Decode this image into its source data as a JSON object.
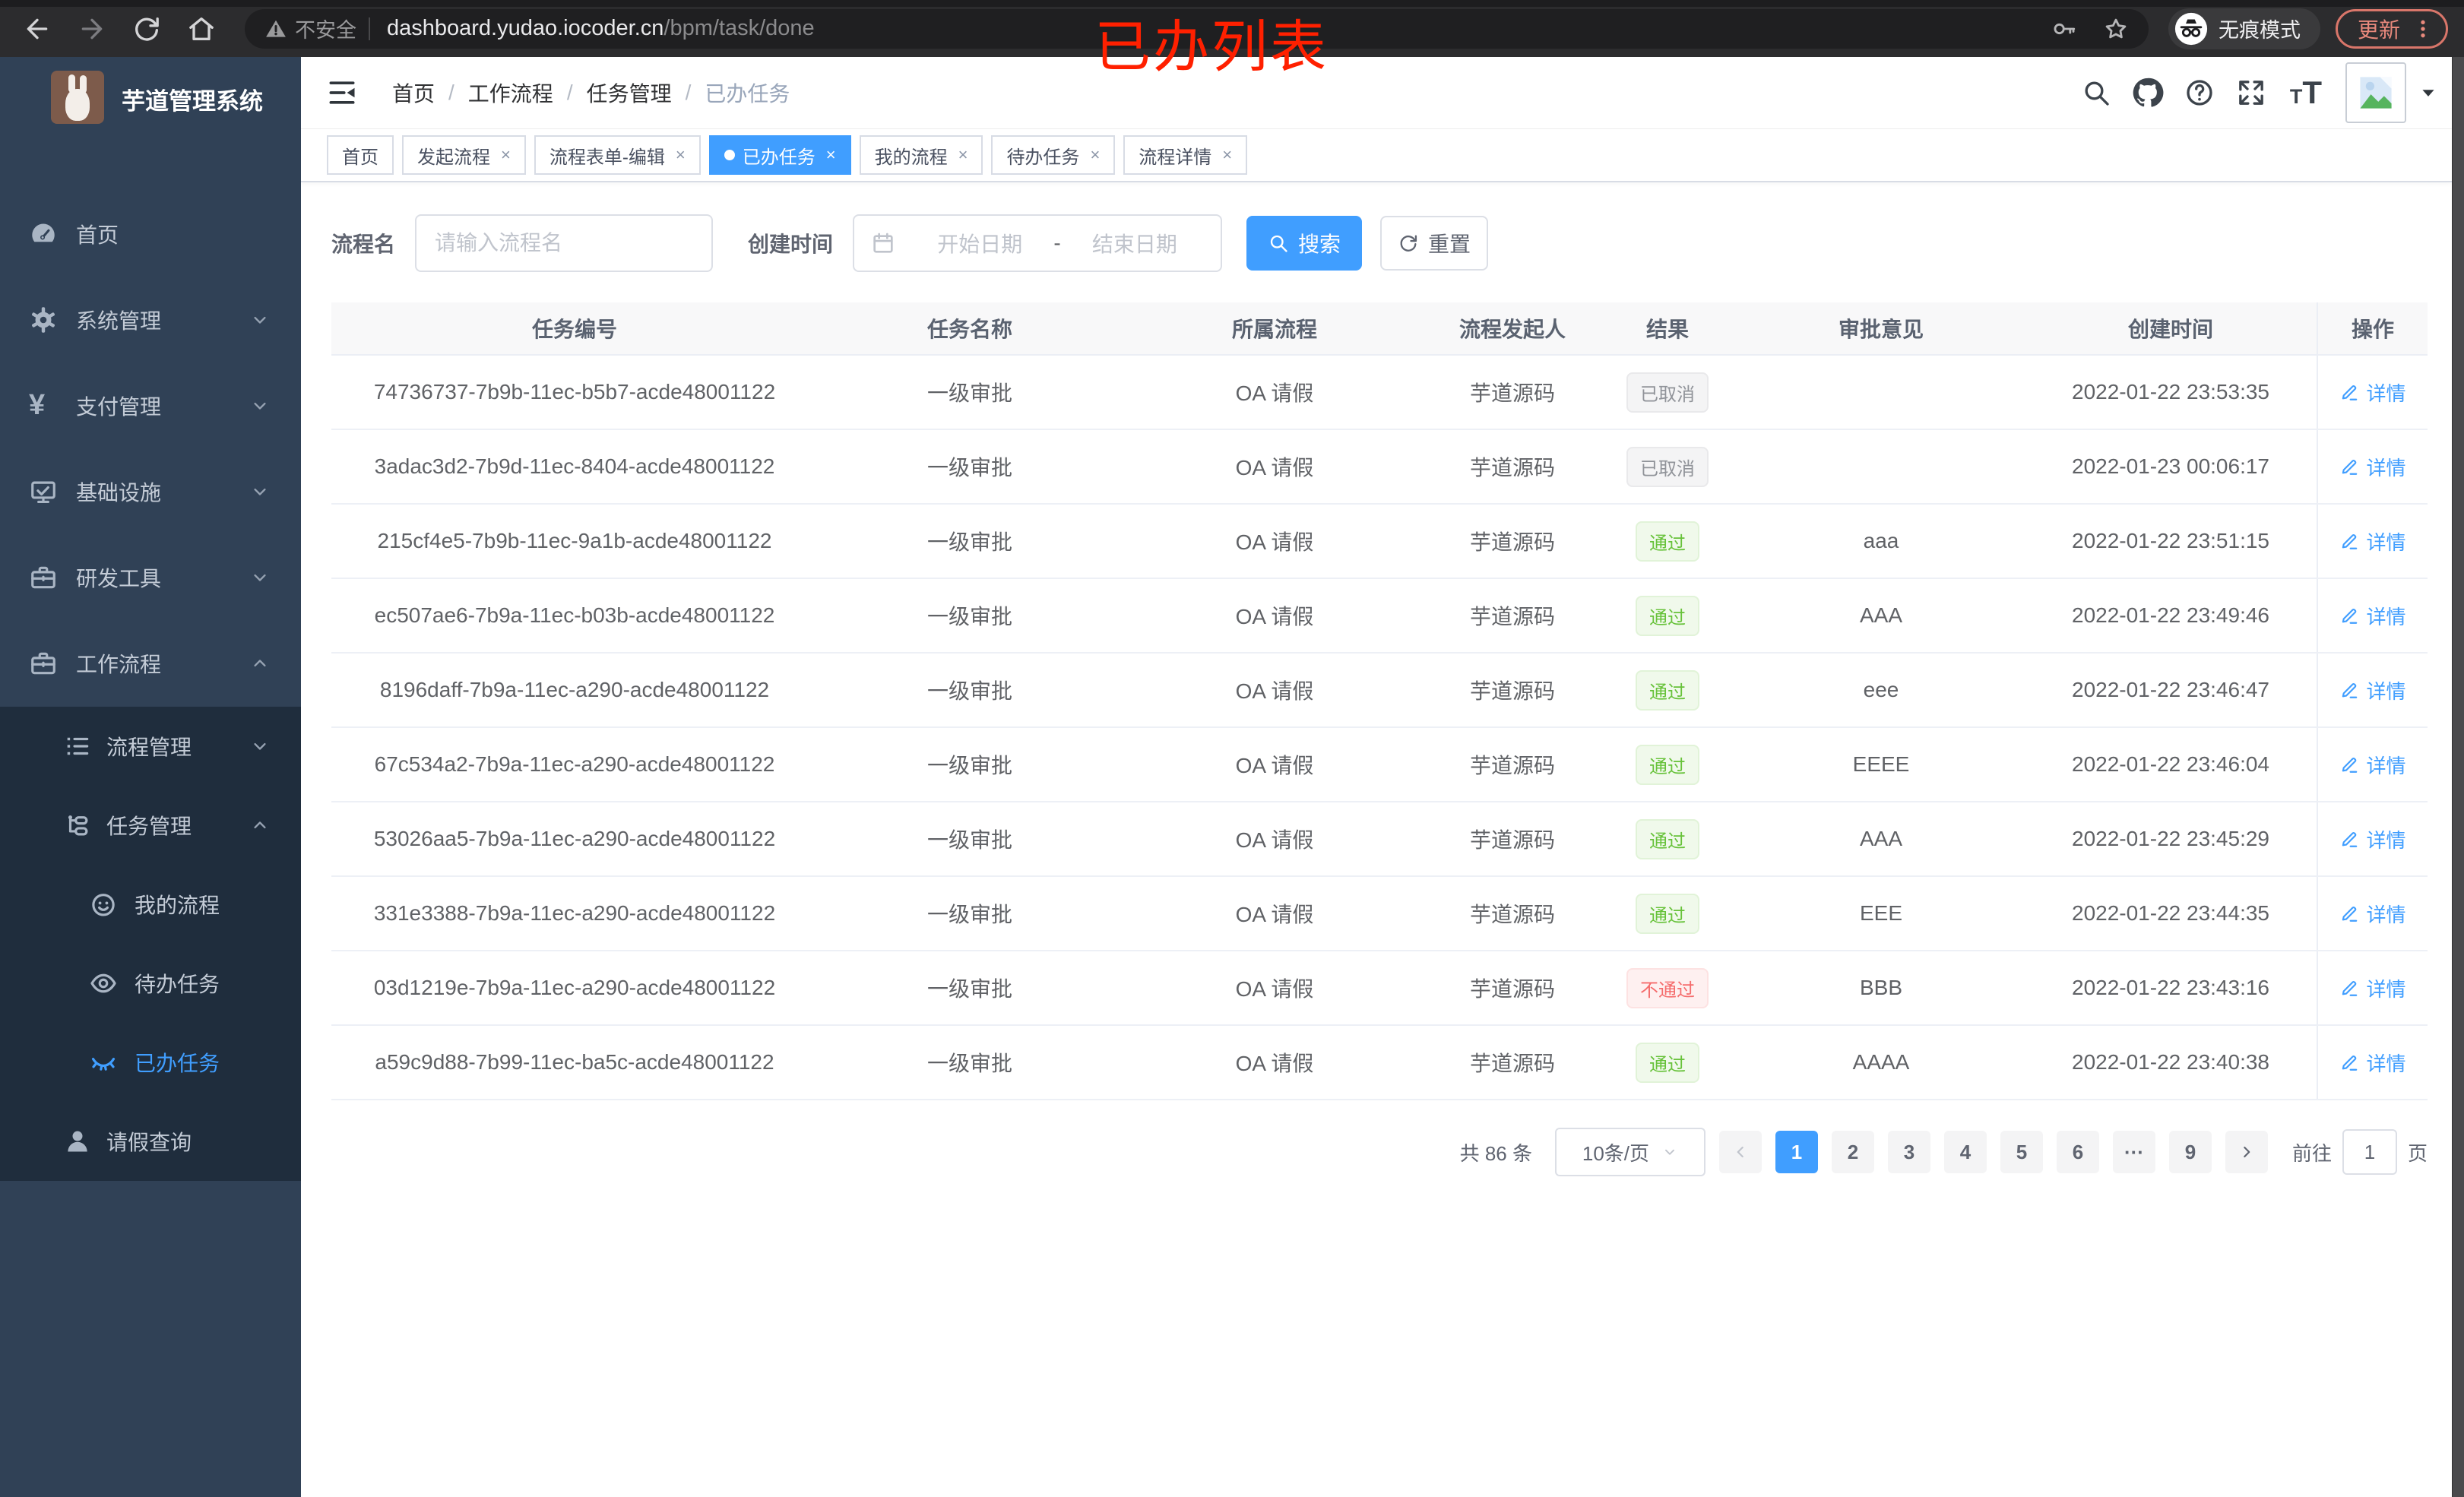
{
  "annotation": {
    "text": "已办列表",
    "color": "#ff2000"
  },
  "browser": {
    "icons": [
      "back-icon",
      "forward-icon",
      "reload-icon",
      "home-icon"
    ],
    "insecure_label": "不安全",
    "url_host": "dashboard.yudao.iocoder.cn",
    "url_path": "/bpm/task/done",
    "tail_icons": [
      "key-icon",
      "star-icon"
    ],
    "incognito_label": "无痕模式",
    "update_label": "更新"
  },
  "sidebar": {
    "title": "芋道管理系统",
    "bg_color": "#304156",
    "submenu_bg_color": "#1f2d3d",
    "menu": [
      {
        "label": "首页",
        "icon": "dashboard-icon"
      },
      {
        "label": "系统管理",
        "icon": "gear-icon",
        "chevron": "down"
      },
      {
        "label": "支付管理",
        "icon": "yen-icon",
        "chevron": "down"
      },
      {
        "label": "基础设施",
        "icon": "monitor-icon",
        "chevron": "down"
      },
      {
        "label": "研发工具",
        "icon": "briefcase-icon",
        "chevron": "down"
      },
      {
        "label": "工作流程",
        "icon": "briefcase-icon",
        "chevron": "up"
      }
    ],
    "submenu": [
      {
        "label": "流程管理",
        "icon": "list-icon",
        "chevron": "down"
      },
      {
        "label": "任务管理",
        "icon": "org-tree-icon",
        "chevron": "up"
      },
      {
        "label": "我的流程",
        "icon": "face-icon"
      },
      {
        "label": "待办任务",
        "icon": "eye-icon"
      },
      {
        "label": "已办任务",
        "icon": "eye-closed-icon",
        "active": true
      },
      {
        "label": "请假查询",
        "icon": "user-icon"
      }
    ]
  },
  "header": {
    "breadcrumb": [
      "首页",
      "工作流程",
      "任务管理",
      "已办任务"
    ],
    "right_icons": [
      "search-icon",
      "github-icon",
      "help-icon",
      "fullscreen-icon",
      "font-size-icon",
      "avatar",
      "caret-down-icon"
    ]
  },
  "tabs": [
    {
      "label": "首页",
      "closable": false,
      "active": false
    },
    {
      "label": "发起流程",
      "closable": true,
      "active": false
    },
    {
      "label": "流程表单-编辑",
      "closable": true,
      "active": false
    },
    {
      "label": "已办任务",
      "closable": true,
      "active": true
    },
    {
      "label": "我的流程",
      "closable": true,
      "active": false
    },
    {
      "label": "待办任务",
      "closable": true,
      "active": false
    },
    {
      "label": "流程详情",
      "closable": true,
      "active": false
    }
  ],
  "filters": {
    "name_label": "流程名",
    "name_placeholder": "请输入流程名",
    "time_label": "创建时间",
    "start_placeholder": "开始日期",
    "range_separator": "-",
    "end_placeholder": "结束日期",
    "search_label": "搜索",
    "reset_label": "重置"
  },
  "table": {
    "columns": [
      "任务编号",
      "任务名称",
      "所属流程",
      "流程发起人",
      "结果",
      "审批意见",
      "创建时间",
      "操作"
    ],
    "detail_label": "详情",
    "rows": [
      {
        "id": "74736737-7b9b-11ec-b5b7-acde48001122",
        "name": "一级审批",
        "process": "OA 请假",
        "starter": "芋道源码",
        "result": "已取消",
        "result_type": "info",
        "opinion": "",
        "created": "2022-01-22 23:53:35"
      },
      {
        "id": "3adac3d2-7b9d-11ec-8404-acde48001122",
        "name": "一级审批",
        "process": "OA 请假",
        "starter": "芋道源码",
        "result": "已取消",
        "result_type": "info",
        "opinion": "",
        "created": "2022-01-23 00:06:17"
      },
      {
        "id": "215cf4e5-7b9b-11ec-9a1b-acde48001122",
        "name": "一级审批",
        "process": "OA 请假",
        "starter": "芋道源码",
        "result": "通过",
        "result_type": "success",
        "opinion": "aaa",
        "created": "2022-01-22 23:51:15"
      },
      {
        "id": "ec507ae6-7b9a-11ec-b03b-acde48001122",
        "name": "一级审批",
        "process": "OA 请假",
        "starter": "芋道源码",
        "result": "通过",
        "result_type": "success",
        "opinion": "AAA",
        "created": "2022-01-22 23:49:46"
      },
      {
        "id": "8196daff-7b9a-11ec-a290-acde48001122",
        "name": "一级审批",
        "process": "OA 请假",
        "starter": "芋道源码",
        "result": "通过",
        "result_type": "success",
        "opinion": "eee",
        "created": "2022-01-22 23:46:47"
      },
      {
        "id": "67c534a2-7b9a-11ec-a290-acde48001122",
        "name": "一级审批",
        "process": "OA 请假",
        "starter": "芋道源码",
        "result": "通过",
        "result_type": "success",
        "opinion": "EEEE",
        "created": "2022-01-22 23:46:04"
      },
      {
        "id": "53026aa5-7b9a-11ec-a290-acde48001122",
        "name": "一级审批",
        "process": "OA 请假",
        "starter": "芋道源码",
        "result": "通过",
        "result_type": "success",
        "opinion": "AAA",
        "created": "2022-01-22 23:45:29"
      },
      {
        "id": "331e3388-7b9a-11ec-a290-acde48001122",
        "name": "一级审批",
        "process": "OA 请假",
        "starter": "芋道源码",
        "result": "通过",
        "result_type": "success",
        "opinion": "EEE",
        "created": "2022-01-22 23:44:35"
      },
      {
        "id": "03d1219e-7b9a-11ec-a290-acde48001122",
        "name": "一级审批",
        "process": "OA 请假",
        "starter": "芋道源码",
        "result": "不通过",
        "result_type": "danger",
        "opinion": "BBB",
        "created": "2022-01-22 23:43:16"
      },
      {
        "id": "a59c9d88-7b99-11ec-ba5c-acde48001122",
        "name": "一级审批",
        "process": "OA 请假",
        "starter": "芋道源码",
        "result": "通过",
        "result_type": "success",
        "opinion": "AAAA",
        "created": "2022-01-22 23:40:38"
      }
    ]
  },
  "pagination": {
    "total_label": "共 86 条",
    "page_size": "10条/页",
    "pages": [
      "1",
      "2",
      "3",
      "4",
      "5",
      "6",
      "···",
      "9"
    ],
    "active_page": "1",
    "goto_label": "前往",
    "goto_value": "1",
    "page_unit": "页"
  },
  "colors": {
    "accent": "#409eff",
    "success": "#67c23a",
    "danger": "#f56c6c",
    "info": "#909399",
    "sidebar": "#304156",
    "submenu": "#1f2d3d",
    "annotation": "#ff2000"
  }
}
